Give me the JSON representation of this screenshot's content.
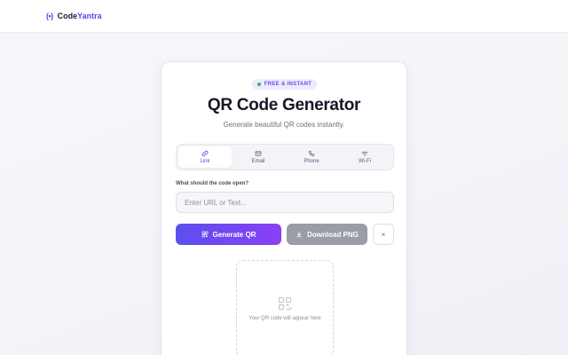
{
  "header": {
    "logo_mark": "(•)",
    "brand_part1": "Code",
    "brand_part2": "Yantra"
  },
  "badge": {
    "label": "FREE & INSTANT"
  },
  "hero": {
    "title": "QR Code Generator",
    "subtitle": "Generate beautiful QR codes instantly."
  },
  "tabs": [
    {
      "label": "Link",
      "icon": "link-icon",
      "active": true
    },
    {
      "label": "Email",
      "icon": "mail-icon",
      "active": false
    },
    {
      "label": "Phone",
      "icon": "phone-icon",
      "active": false
    },
    {
      "label": "Wi-Fi",
      "icon": "wifi-icon",
      "active": false
    }
  ],
  "form": {
    "field_label": "What should the code open?",
    "input_value": "",
    "input_placeholder": "Enter URL or Text..."
  },
  "actions": {
    "generate_label": "Generate QR",
    "download_label": "Download PNG",
    "clear_label": "×"
  },
  "preview": {
    "placeholder_text": "Your QR code will appear here"
  },
  "colors": {
    "accent": "#6d3cf0",
    "gradient_start": "#5b4ff0",
    "gradient_end": "#8a3ff2",
    "disabled": "#9a9ca6",
    "badge_dot": "#2fb37a"
  }
}
